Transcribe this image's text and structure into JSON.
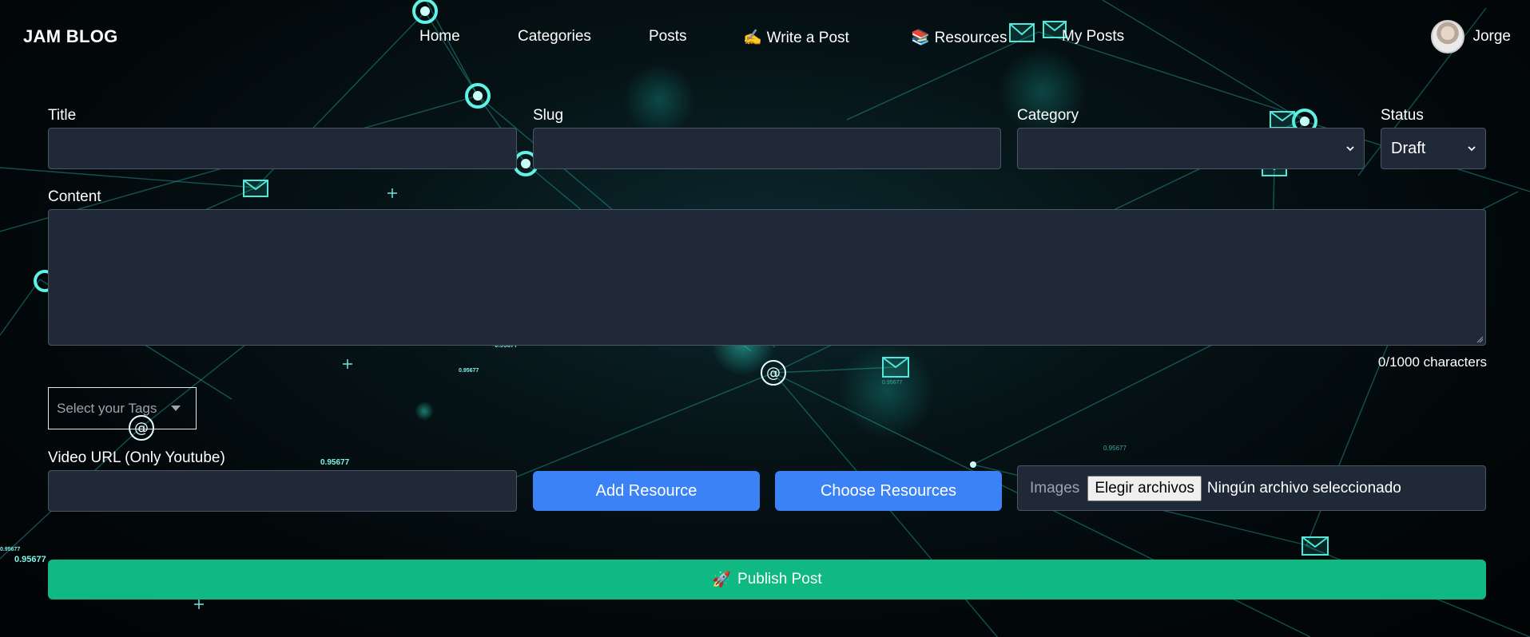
{
  "nav": {
    "brand": "JAM BLOG",
    "items": [
      {
        "label": "Home",
        "emoji": ""
      },
      {
        "label": "Categories",
        "emoji": ""
      },
      {
        "label": "Posts",
        "emoji": ""
      },
      {
        "label": "Write a Post",
        "emoji": "✍️"
      },
      {
        "label": "Resources",
        "emoji": "📚"
      },
      {
        "label": "My Posts",
        "emoji": ""
      }
    ],
    "user": {
      "name": "Jorge"
    }
  },
  "form": {
    "title_label": "Title",
    "title_value": "",
    "slug_label": "Slug",
    "slug_value": "",
    "category_label": "Category",
    "category_value": "",
    "status_label": "Status",
    "status_value": "Draft",
    "content_label": "Content",
    "content_value": "",
    "char_counter": "0/1000 characters",
    "tags_placeholder": "Select your Tags",
    "video_label": "Video URL (Only Youtube)",
    "video_value": "",
    "add_resource": "Add Resource",
    "choose_resources": "Choose Resources",
    "images_label": "Images",
    "file_button": "Elegir archivos",
    "file_status": "Ningún archivo seleccionado",
    "publish_emoji": "🚀",
    "publish_label": "Publish Post"
  },
  "background": {
    "floating_numbers": [
      "0.95677",
      "0.95677",
      "0.95677",
      "0.95677",
      "0.95677",
      "0.95677",
      "0.95677"
    ]
  },
  "colors": {
    "accent_blue": "#3b82f6",
    "publish_green": "#10b981",
    "field_bg": "#1f2937",
    "field_border": "#4b5563",
    "network_cyan": "#2dd4bf"
  }
}
